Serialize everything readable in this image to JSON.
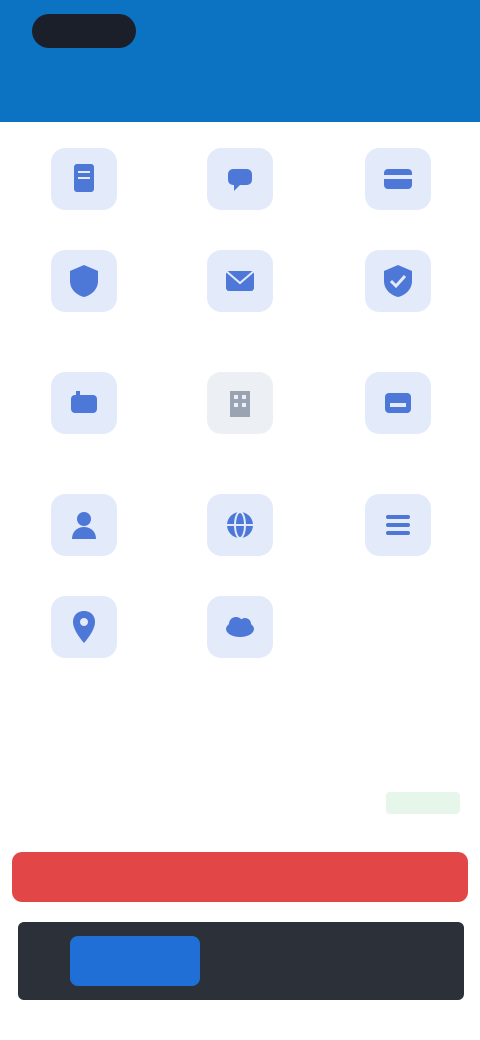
{
  "header": {
    "status_left": "",
    "status_right": "",
    "title": ""
  },
  "grid": {
    "items": [
      {
        "label": "",
        "icon": "document-icon"
      },
      {
        "label": "",
        "icon": "chat-icon"
      },
      {
        "label": "",
        "icon": "card-icon"
      },
      {
        "label": "",
        "icon": "shield-icon"
      },
      {
        "label": "",
        "icon": "mail-icon"
      },
      {
        "label": "",
        "icon": "shield-check-icon"
      },
      {
        "label": "",
        "icon": "mailbox-icon"
      },
      {
        "label": "",
        "icon": "building-icon"
      },
      {
        "label": "",
        "icon": "tray-icon"
      },
      {
        "label": "",
        "icon": "person-icon"
      },
      {
        "label": "",
        "icon": "globe-icon"
      },
      {
        "label": "",
        "icon": "list-icon"
      },
      {
        "label": "",
        "icon": "location-icon"
      },
      {
        "label": "",
        "icon": "cloud-icon"
      }
    ]
  },
  "info": {
    "row1_label": "",
    "row2_label": "",
    "row3_label": "",
    "row1_value": "",
    "row2_value": "",
    "row4_label": "",
    "status_chip": ""
  },
  "actions": {
    "danger_label": ""
  },
  "banner": {
    "button_label": "",
    "text": ""
  },
  "colors": {
    "header": "#0b73c2",
    "icon_bg": "#e3ebfb",
    "icon_fg": "#4d78d8",
    "danger": "#e24646",
    "banner": "#2c3139"
  }
}
